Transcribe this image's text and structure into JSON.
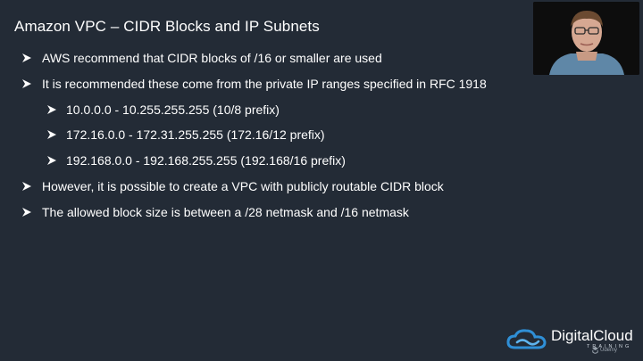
{
  "slide": {
    "title": "Amazon VPC – CIDR Blocks and IP Subnets",
    "bullets": [
      {
        "level": 1,
        "text": "AWS recommend that CIDR blocks of /16 or smaller are used"
      },
      {
        "level": 1,
        "text": "It is recommended these come from the private IP ranges specified in RFC 1918"
      },
      {
        "level": 2,
        "text": "10.0.0.0 - 10.255.255.255 (10/8 prefix)"
      },
      {
        "level": 2,
        "text": "172.16.0.0 - 172.31.255.255 (172.16/12 prefix)"
      },
      {
        "level": 2,
        "text": "192.168.0.0 - 192.168.255.255 (192.168/16 prefix)"
      },
      {
        "level": 1,
        "text": "However, it is possible to create a VPC with publicly routable CIDR block"
      },
      {
        "level": 1,
        "text": "The allowed block size is between a /28 netmask and /16 netmask"
      }
    ]
  },
  "branding": {
    "logo_name": "DigitalCloud",
    "logo_sub": "TRAINING",
    "watermark": "Udemy"
  },
  "colors": {
    "background": "#232b36",
    "text": "#ffffff",
    "logo_accent": "#2f8fd6"
  },
  "icons": {
    "bullet": "arrow-bullet-icon",
    "logo": "cloud-logo-icon",
    "watermark": "udemy-logo-icon"
  }
}
